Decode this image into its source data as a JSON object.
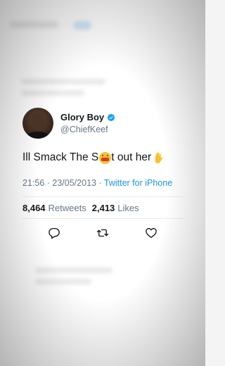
{
  "tweet": {
    "display_name": "Glory Boy",
    "handle": "@ChiefKeef",
    "text_part1": "Ill Smack The S",
    "text_part2": "t out her",
    "time": "21:56",
    "date": "23/05/2013",
    "source": "Twitter for iPhone",
    "retweets_count": "8,464",
    "retweets_label": "Retweets",
    "likes_count": "2,413",
    "likes_label": "Likes"
  },
  "icons": {
    "verified": "verified-badge-icon",
    "reply": "reply-icon",
    "retweet": "retweet-icon",
    "like": "heart-icon"
  },
  "colors": {
    "accent": "#1da1f2",
    "text": "#14171a",
    "muted": "#657786"
  }
}
